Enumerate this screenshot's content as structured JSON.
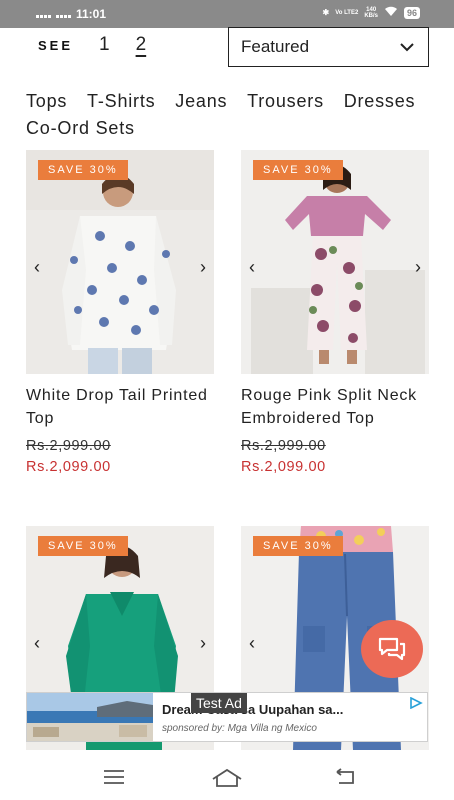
{
  "status_bar": {
    "time": "11:01",
    "network": "Vo LTE2",
    "speed": "140",
    "speed_unit": "KB/s",
    "battery": "96"
  },
  "pagination": {
    "see_label": "SEE",
    "pages": [
      "1",
      "2"
    ],
    "active_page": "2"
  },
  "sort": {
    "selected": "Featured"
  },
  "categories": [
    "Tops",
    "T-Shirts",
    "Jeans",
    "Trousers",
    "Dresses",
    "Co-Ord Sets"
  ],
  "products": [
    {
      "badge": "SAVE 30%",
      "name": "White Drop Tail Printed Top",
      "old_price": "Rs.2,999.00",
      "new_price": "Rs.2,099.00"
    },
    {
      "badge": "SAVE 30%",
      "name": "Rouge Pink Split Neck Embroidered Top",
      "old_price": "Rs.2,999.00",
      "new_price": "Rs.2,099.00"
    },
    {
      "badge": "SAVE 30%"
    },
    {
      "badge": "SAVE 30%"
    }
  ],
  "ad": {
    "label": "Test Ad",
    "title": "Dream Casa sa Uupahan sa...",
    "sponsor": "sponsored by: Mga Villa ng Mexico"
  },
  "colors": {
    "badge": "#ea7d3c",
    "sale_price": "#c83232",
    "chat_fab": "#ec6a56"
  }
}
